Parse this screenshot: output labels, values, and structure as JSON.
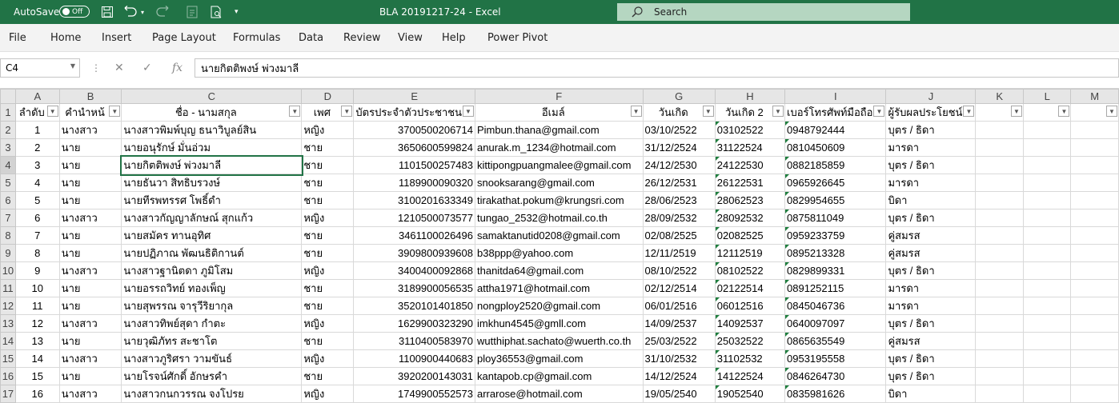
{
  "titlebar": {
    "autosave_label": "AutoSave",
    "autosave_state": "Off",
    "doc_title": "BLA 20191217-24  -  Excel",
    "search_placeholder": "Search"
  },
  "menu": [
    "File",
    "Home",
    "Insert",
    "Page Layout",
    "Formulas",
    "Data",
    "Review",
    "View",
    "Help",
    "Power Pivot"
  ],
  "formula_bar": {
    "cell_ref": "C4",
    "content": "นายกิตติพงษ์ พ่วงมาลี"
  },
  "columns": [
    "A",
    "B",
    "C",
    "D",
    "E",
    "F",
    "G",
    "H",
    "I",
    "J",
    "K",
    "L",
    "M"
  ],
  "header_row": [
    "ลำดับ",
    "คำนำหน้",
    "ชื่อ - นามสกุล",
    "เพศ",
    "บัตรประจำตัวประชาชน",
    "อีเมล์",
    "วันเกิด",
    "วันเกิด 2",
    "เบอร์โทรศัพท์มือถือ",
    "ผู้รับผลประโยชน์",
    "",
    "",
    ""
  ],
  "rows": [
    [
      "1",
      "นางสาว",
      "นางสาวพิมพ์บุญ ธนาวิบูลย์สิน",
      "หญิง",
      "3700500206714",
      "Pimbun.thana@gmail.com",
      "03/10/2522",
      "03102522",
      "0948792444",
      "บุตร / ธิดา"
    ],
    [
      "2",
      "นาย",
      "นายอนุรักษ์ มั่นอ่วม",
      "ชาย",
      "3650600599824",
      "anurak.m_1234@hotmail.com",
      "31/12/2524",
      "31122524",
      "0810450609",
      "มารดา"
    ],
    [
      "3",
      "นาย",
      "นายกิตติพงษ์ พ่วงมาลี",
      "ชาย",
      "1101500257483",
      "kittipongpuangmalee@gmail.com",
      "24/12/2530",
      "24122530",
      "0882185859",
      "บุตร / ธิดา"
    ],
    [
      "4",
      "นาย",
      "นายธันวา สิทธิบรวงษ์",
      "ชาย",
      "1189900090320",
      "snooksarang@gmail.com",
      "26/12/2531",
      "26122531",
      "0965926645",
      "มารดา"
    ],
    [
      "5",
      "นาย",
      "นายทีรพทรรศ โพธิ์ดำ",
      "ชาย",
      "3100201633349",
      "tirakathat.pokum@krungsri.com",
      "28/06/2523",
      "28062523",
      "0829954655",
      "บิดา"
    ],
    [
      "6",
      "นางสาว",
      "นางสาวกัญญาลักษณ์ สุกแก้ว",
      "หญิง",
      "1210500073577",
      "tungao_2532@hotmail.co.th",
      "28/09/2532",
      "28092532",
      "0875811049",
      "บุตร / ธิดา"
    ],
    [
      "7",
      "นาย",
      "นายสมัคร ทานอุทิศ",
      "ชาย",
      "3461100026496",
      "samaktanutid0208@gmail.com",
      "02/08/2525",
      "02082525",
      "0959233759",
      "คู่สมรส"
    ],
    [
      "8",
      "นาย",
      "นายปฏิภาณ พัฒนธิติกานต์",
      "ชาย",
      "3909800939608",
      "b38ppp@yahoo.com",
      "12/11/2519",
      "12112519",
      "0895213328",
      "คู่สมรส"
    ],
    [
      "9",
      "นางสาว",
      "นางสาวฐานิตดา ภูมิโสม",
      "หญิง",
      "3400400092868",
      "thanitda64@gmail.com",
      "08/10/2522",
      "08102522",
      "0829899331",
      "บุตร / ธิดา"
    ],
    [
      "10",
      "นาย",
      "นายอรรถวิทย์ ทองเพ็ญ",
      "ชาย",
      "3189900056535",
      "attha1971@hotmail.com",
      "02/12/2514",
      "02122514",
      "0891252115",
      "มารดา"
    ],
    [
      "11",
      "นาย",
      "นายสุพรรณ จารุวีริยากุล",
      "ชาย",
      "3520101401850",
      "nongploy2520@gmail.com",
      "06/01/2516",
      "06012516",
      "0845046736",
      "มารดา"
    ],
    [
      "12",
      "นางสาว",
      "นางสาวทิพย์สุดา กำตะ",
      "หญิง",
      "1629900323290",
      "imkhun4545@gmll.com",
      "14/09/2537",
      "14092537",
      "0640097097",
      "บุตร / ธิดา"
    ],
    [
      "13",
      "นาย",
      "นายวุฒิภัทร สะชาโต",
      "ชาย",
      "3110400583970",
      "wutthiphat.sachato@wuerth.co.th",
      "25/03/2522",
      "25032522",
      "0865635549",
      "คู่สมรส"
    ],
    [
      "14",
      "นางสาว",
      "นางสาวภูริศรา วามขันธ์",
      "หญิง",
      "1100900440683",
      "ploy36553@gmail.com",
      "31/10/2532",
      "31102532",
      "0953195558",
      "บุตร / ธิดา"
    ],
    [
      "15",
      "นาย",
      "นายโรจน์ศักดิ์ อักษรคำ",
      "ชาย",
      "3920200143031",
      "kantapob.cp@gmail.com",
      "14/12/2524",
      "14122524",
      "0846264730",
      "บุตร / ธิดา"
    ],
    [
      "16",
      "นางสาว",
      "นางสาวกนกวรรณ จงโปรย",
      "หญิง",
      "1749900552573",
      "arrarose@hotmail.com",
      "19/05/2540",
      "19052540",
      "0835981626",
      "บิดา"
    ]
  ]
}
